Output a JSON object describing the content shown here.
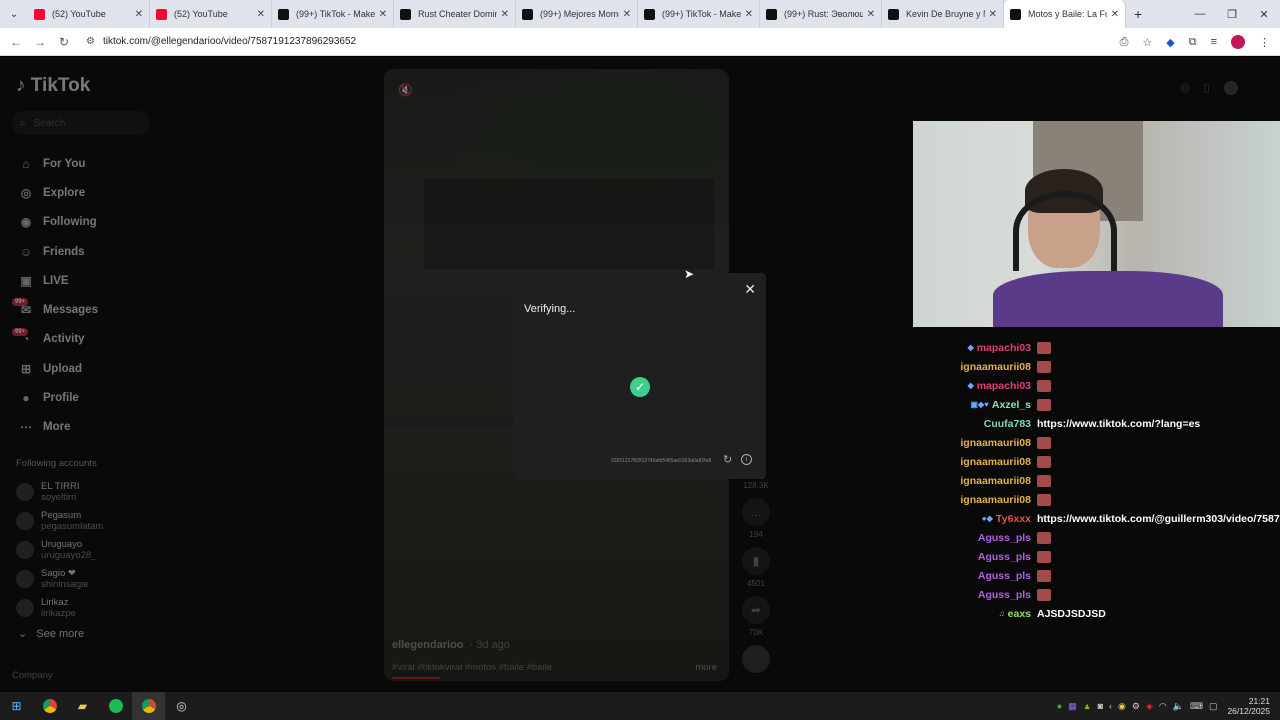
{
  "tabs": [
    {
      "label": "(52) YouTube",
      "icon": "youtube-icon"
    },
    {
      "label": "(52) YouTube",
      "icon": "youtube-icon"
    },
    {
      "label": "(99+) TikTok - Make Y",
      "icon": "tiktok-icon"
    },
    {
      "label": "Rust Cheater Domine",
      "icon": "tiktok-icon"
    },
    {
      "label": "(99+) Mejores Momen",
      "icon": "tiktok-icon"
    },
    {
      "label": "(99+) TikTok - Make Y",
      "icon": "tiktok-icon"
    },
    {
      "label": "(99+) Rust: Эволюци",
      "icon": "tiktok-icon"
    },
    {
      "label": "Kevin De Bruyne y M",
      "icon": "tiktok-icon"
    },
    {
      "label": "Motos y Baile: La Fu",
      "icon": "tiktok-icon",
      "active": true
    }
  ],
  "address": {
    "url": "tiktok.com/@ellegendarioo/video/7587191237896293652"
  },
  "tiktok": {
    "logo": "TikTok",
    "search_placeholder": "Search",
    "nav": [
      {
        "label": "For You",
        "icon": "home-icon"
      },
      {
        "label": "Explore",
        "icon": "compass-icon"
      },
      {
        "label": "Following",
        "icon": "following-icon"
      },
      {
        "label": "Friends",
        "icon": "friends-icon"
      },
      {
        "label": "LIVE",
        "icon": "live-icon"
      },
      {
        "label": "Messages",
        "icon": "messages-icon",
        "badge": "99+"
      },
      {
        "label": "Activity",
        "icon": "activity-icon",
        "badge": "99+"
      },
      {
        "label": "Upload",
        "icon": "upload-icon"
      },
      {
        "label": "Profile",
        "icon": "profile-icon"
      },
      {
        "label": "More",
        "icon": "more-icon"
      }
    ],
    "following_title": "Following accounts",
    "following": [
      {
        "name": "EL TIRRI",
        "handle": "soyeltirri"
      },
      {
        "name": "Pegasum",
        "handle": "pegasumlatam"
      },
      {
        "name": "Uruguayo",
        "handle": "uruguayo28_"
      },
      {
        "name": "Sagio ❤",
        "handle": "shininsagie"
      },
      {
        "name": "Lirikaz",
        "handle": "lirikazpe"
      }
    ],
    "see_more": "See more",
    "company": "Company",
    "video": {
      "author": "ellegendarioo",
      "date": "· 3d ago",
      "hashtags": "#viral #tiktokviral #motos #baile #baile",
      "more": "more"
    },
    "actions": [
      {
        "icon": "like-icon",
        "count": "128.3K"
      },
      {
        "icon": "comment-icon",
        "count": "194"
      },
      {
        "icon": "bookmark-icon",
        "count": "4501"
      },
      {
        "icon": "share-icon",
        "count": "70K"
      }
    ]
  },
  "modal": {
    "title": "Verifying...",
    "code": "20251227f02f13740afd5465ae5363a0a82fe8"
  },
  "chat": [
    {
      "user": "mapachi03",
      "color": "#e0407a",
      "msg": "",
      "emote": true,
      "badge": "◆"
    },
    {
      "user": "ignaamaurii08",
      "color": "#e8b04a",
      "msg": "",
      "emote": true,
      "badge": ""
    },
    {
      "user": "mapachi03",
      "color": "#e0407a",
      "msg": "",
      "emote": true,
      "badge": "◆"
    },
    {
      "user": "Axzel_s",
      "color": "#8fe0b0",
      "msg": "",
      "emote": true,
      "badge": "▣◆♥"
    },
    {
      "user": "Cuufa783",
      "color": "#7fd4c0",
      "msg": "https://www.tiktok.com/?lang=es",
      "emote": false,
      "badge": ""
    },
    {
      "user": "ignaamaurii08",
      "color": "#e8b04a",
      "msg": "",
      "emote": true,
      "badge": ""
    },
    {
      "user": "ignaamaurii08",
      "color": "#e8b04a",
      "msg": "",
      "emote": true,
      "badge": ""
    },
    {
      "user": "ignaamaurii08",
      "color": "#e8b04a",
      "msg": "",
      "emote": true,
      "badge": ""
    },
    {
      "user": "ignaamaurii08",
      "color": "#e8b04a",
      "msg": "",
      "emote": true,
      "badge": ""
    },
    {
      "user": "Ту6xxx",
      "color": "#e05050",
      "msg": "https://www.tiktok.com/@guillerm303/video/758741",
      "emote": false,
      "badge": "●◆"
    },
    {
      "user": "Aguss_pls",
      "color": "#b060e0",
      "msg": "",
      "emote": true,
      "badge": ""
    },
    {
      "user": "Aguss_pls",
      "color": "#b060e0",
      "msg": "",
      "emote": true,
      "badge": ""
    },
    {
      "user": "Aguss_pls",
      "color": "#b060e0",
      "msg": "",
      "emote": true,
      "badge": ""
    },
    {
      "user": "Aguss_pls",
      "color": "#b060e0",
      "msg": "",
      "emote": true,
      "badge": ""
    },
    {
      "user": "eaxs",
      "color": "#8fe060",
      "msg": "AJSDJSDJSD",
      "emote": false,
      "badge": "♫"
    }
  ],
  "taskbar": {
    "items": [
      "windows-start-icon",
      "chrome-icon",
      "file-explorer-icon",
      "spotify-icon",
      "chrome-active-icon",
      "obs-icon"
    ],
    "time": "21:21",
    "date": "26/12/2025"
  }
}
